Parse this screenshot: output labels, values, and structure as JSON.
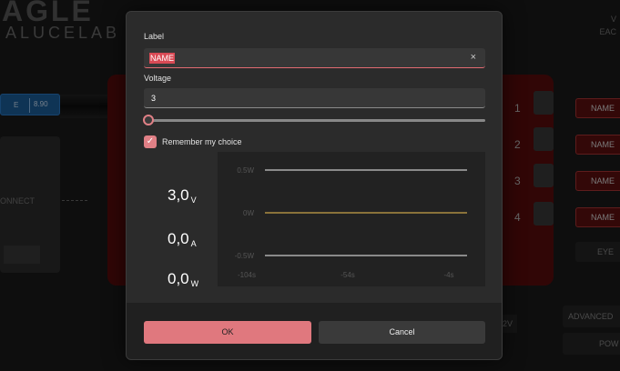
{
  "background": {
    "logo": "AGLE",
    "logo_sub": "ALUCELAB",
    "top_right_1": "V",
    "top_right_2": "EAC",
    "voltage_chip": "E",
    "voltage_value": "8.90",
    "connect_label": "ONNECT",
    "ports": [
      "1",
      "2",
      "3",
      "4"
    ],
    "name_buttons": [
      "NAME",
      "NAME",
      "NAME",
      "NAME"
    ],
    "eye_label": "EYE",
    "advanced_label": "ADVANCED",
    "power_label": "POW",
    "v_label": "2V"
  },
  "dialog": {
    "label_title": "Label",
    "label_value": "NAME",
    "clear_symbol": "×",
    "voltage_title": "Voltage",
    "voltage_value": "3",
    "slider_fraction": 0.02,
    "remember_label": "Remember my choice",
    "remember_checked": true,
    "readouts": [
      {
        "value": "3,0",
        "unit": "V"
      },
      {
        "value": "0,0",
        "unit": "A"
      },
      {
        "value": "0,0",
        "unit": "W"
      }
    ],
    "ok_label": "OK",
    "cancel_label": "Cancel"
  },
  "chart_data": {
    "type": "line",
    "y_tick_labels": [
      "0.5W",
      "0W",
      "-0.5W"
    ],
    "x_tick_labels": [
      "-104s",
      "-54s",
      "-4s"
    ],
    "series": [
      {
        "values": [
          0.5,
          0.5
        ],
        "color": "#c9c9c9"
      },
      {
        "values": [
          0,
          0
        ],
        "color": "#c9a24a"
      },
      {
        "values": [
          -0.5,
          -0.5
        ],
        "color": "#c9c9c9"
      }
    ],
    "x": [
      -104,
      -4
    ],
    "ylim": [
      -0.5,
      0.5
    ]
  },
  "colors": {
    "accent": "#e0787e",
    "focus_underline": "#e26b72"
  }
}
